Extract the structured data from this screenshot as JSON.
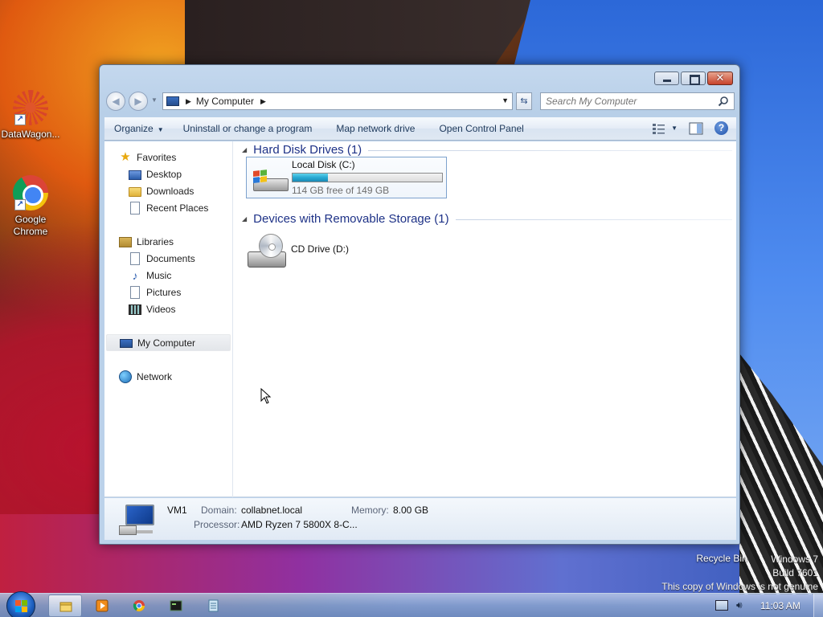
{
  "desktop": {
    "icons": [
      {
        "label": "DataWagon..."
      },
      {
        "label": "Google Chrome"
      }
    ],
    "recycle_bin_label": "Recycle Bin",
    "watermark": {
      "line1": "Windows 7",
      "line2": "Build 7601",
      "line3": "This copy of Windows is not genuine"
    }
  },
  "window": {
    "address": {
      "location": "My Computer"
    },
    "search": {
      "placeholder": "Search My Computer"
    },
    "toolbar": {
      "organize": "Organize",
      "uninstall": "Uninstall or change a program",
      "map_drive": "Map network drive",
      "control_panel": "Open Control Panel"
    },
    "nav_pane": {
      "favorites": "Favorites",
      "desktop": "Desktop",
      "downloads": "Downloads",
      "recent": "Recent Places",
      "libraries": "Libraries",
      "documents": "Documents",
      "music": "Music",
      "pictures": "Pictures",
      "videos": "Videos",
      "my_computer": "My Computer",
      "network": "Network"
    },
    "groups": {
      "hdd": "Hard Disk Drives (1)",
      "removable": "Devices with Removable Storage (1)"
    },
    "drives": {
      "local_disk": {
        "name": "Local Disk (C:)",
        "free_text": "114 GB free of 149 GB",
        "used_fraction": 0.235
      },
      "cd_drive": {
        "name": "CD Drive (D:)"
      }
    },
    "details": {
      "computer_name": "VM1",
      "domain_label": "Domain:",
      "domain_value": "collabnet.local",
      "memory_label": "Memory:",
      "memory_value": "8.00 GB",
      "processor_label": "Processor:",
      "processor_value": "AMD Ryzen 7 5800X 8-C..."
    }
  },
  "taskbar": {
    "clock": "11:03 AM",
    "pinned": [
      "windows-explorer",
      "media-player",
      "google-chrome",
      "command-prompt",
      "notepad"
    ]
  },
  "colors": {
    "drive_bar": "#27a9d3",
    "group_title": "#1e3287"
  }
}
